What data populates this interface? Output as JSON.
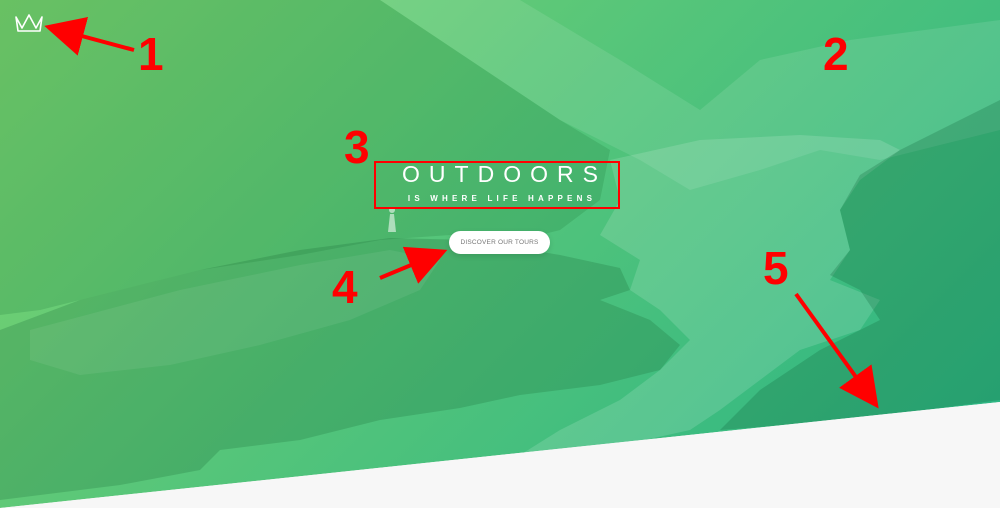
{
  "colors": {
    "gradient_start": "#7ed56f",
    "gradient_mid": "#55c57a",
    "gradient_end": "#28b485",
    "annotation": "#ff0000",
    "section_bg": "#f7f7f7"
  },
  "header": {
    "logo_icon": "crown-icon"
  },
  "hero": {
    "title_main": "OUTDOORS",
    "title_sub": "IS WHERE LIFE HAPPENS",
    "cta_label": "DISCOVER OUR TOURS"
  },
  "annotations": {
    "markers": [
      {
        "label": "1"
      },
      {
        "label": "2"
      },
      {
        "label": "3"
      },
      {
        "label": "4"
      },
      {
        "label": "5"
      }
    ]
  }
}
